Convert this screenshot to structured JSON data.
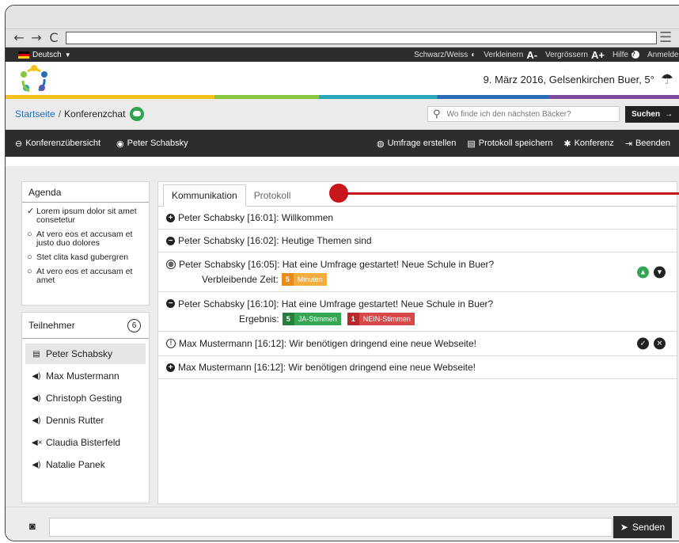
{
  "browser": {
    "back": "←",
    "forward": "→",
    "reload": "C",
    "menu": "☰"
  },
  "topbar": {
    "language": "Deutsch",
    "contrast": "Schwarz/Weiss",
    "smaller": "Verkleinern",
    "smaller_glyph": "A-",
    "bigger": "Vergrössern",
    "bigger_glyph": "A+",
    "help": "Hilfe",
    "login": "Anmelden"
  },
  "header": {
    "date_location": "9. März 2016,  Gelsenkirchen Buer, 5°"
  },
  "breadcrumb": {
    "home": "Startseite",
    "separator": "/",
    "current": "Konferenzchat"
  },
  "search": {
    "placeholder": "Wo finde ich den nächsten Bäcker?",
    "button_label": "Suchen",
    "button_arrow": "→"
  },
  "confbar": {
    "overview": "Konferenzübersicht",
    "user": "Peter Schabsky",
    "create_poll": "Umfrage erstellen",
    "save_protocol": "Protokoll speichern",
    "conference": "Konferenz",
    "end": "Beenden"
  },
  "agenda": {
    "title": "Agenda",
    "items": [
      {
        "icon": "✓",
        "text": "Lorem ipsum dolor sit amet consetetur"
      },
      {
        "icon": "○",
        "text": "At vero eos et accusam et justo duo dolores"
      },
      {
        "icon": "○",
        "text": "Stet clita kasd gubergren"
      },
      {
        "icon": "○",
        "text": "At vero eos et accusam et amet"
      }
    ]
  },
  "participants": {
    "title": "Teilnehmer",
    "count": "6",
    "items": [
      {
        "name": "Peter Schabsky",
        "icon": "document-icon"
      },
      {
        "name": "Max Mustermann",
        "icon": "speaker-icon"
      },
      {
        "name": "Christoph Gesting",
        "icon": "speaker-icon"
      },
      {
        "name": "Dennis Rutter",
        "icon": "speaker-icon"
      },
      {
        "name": "Claudia Bisterfeld",
        "icon": "speaker-muted-icon"
      },
      {
        "name": "Natalie Panek",
        "icon": "speaker-icon"
      }
    ]
  },
  "tabs": {
    "communication": "Kommunikation",
    "protocol": "Protokoll"
  },
  "messages": [
    {
      "text": "Peter Schabsky [16:01]: Willkommen"
    },
    {
      "text": "Peter Schabsky [16:02]: Heutige Themen sind"
    },
    {
      "text": "Peter Schabsky [16:05]: Hat eine Umfrage gestartet! Neue Schule in Buer?",
      "sub_label": "Verbleibende Zeit:",
      "pill_num": "5",
      "pill_text": "Minuten"
    },
    {
      "text": "Peter Schabsky [16:10]: Hat eine Umfrage gestartet! Neue Schule in Buer?",
      "sub_label": "Ergebnis:",
      "yes_num": "5",
      "yes_text": "JA-Stimmen",
      "no_num": "1",
      "no_text": "NEIN-Stimmen"
    },
    {
      "text": "Max Mustermann [16:12]: Wir benötigen dringend eine neue Webseite!"
    },
    {
      "text": "Max Mustermann [16:12]: Wir benötigen dringend eine neue Webseite!"
    }
  ],
  "composer": {
    "send_label": "Senden"
  }
}
